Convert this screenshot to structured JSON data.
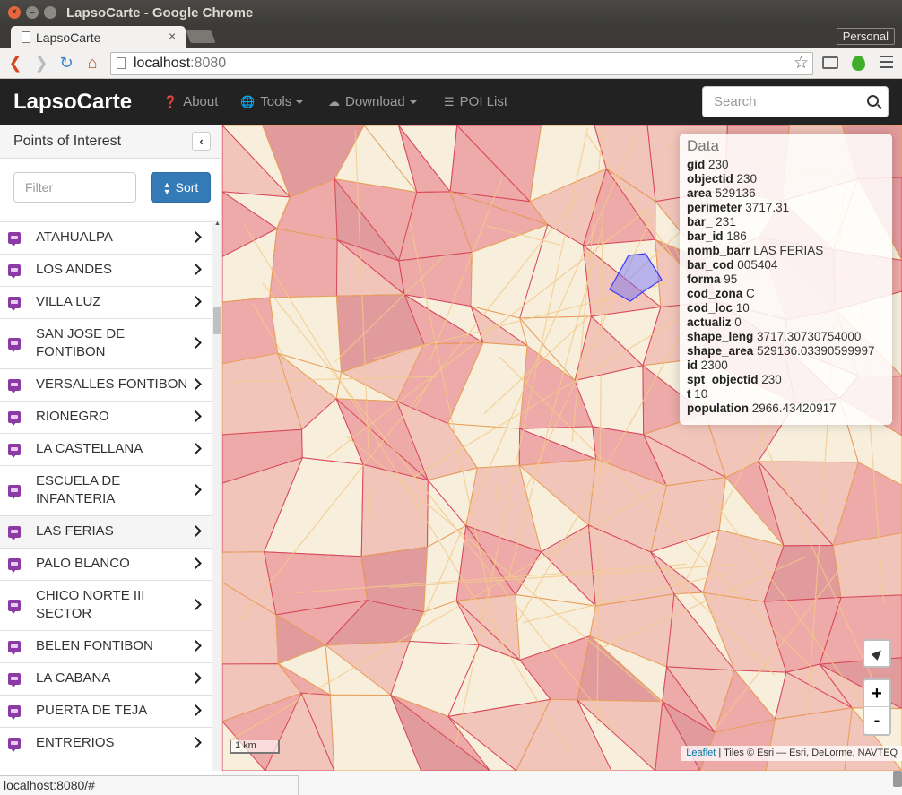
{
  "window": {
    "title": "LapsoCarte - Google Chrome",
    "profile": "Personal"
  },
  "tab": {
    "title": "LapsoCarte",
    "close": "×"
  },
  "omnibox": {
    "host": "localhost",
    "port": ":8080"
  },
  "navbar": {
    "brand": "LapsoCarte",
    "about": "About",
    "tools": "Tools",
    "download": "Download",
    "poi_list": "POI List",
    "search_placeholder": "Search"
  },
  "sidebar": {
    "title": "Points of Interest",
    "filter_placeholder": "Filter",
    "sort_label": "Sort",
    "items": [
      "ATAHUALPA",
      "LOS ANDES",
      "VILLA LUZ",
      "SAN JOSE DE FONTIBON",
      "VERSALLES FONTIBON",
      "RIONEGRO",
      "LA CASTELLANA",
      "ESCUELA DE INFANTERIA",
      "LAS FERIAS",
      "PALO BLANCO",
      "CHICO NORTE III SECTOR",
      "BELEN FONTIBON",
      "LA CABANA",
      "PUERTA DE TEJA",
      "ENTRERIOS"
    ],
    "active_item": "LAS FERIAS"
  },
  "data_panel": {
    "title": "Data",
    "rows": [
      {
        "key": "gid",
        "value": "230"
      },
      {
        "key": "objectid",
        "value": "230"
      },
      {
        "key": "area",
        "value": "529136"
      },
      {
        "key": "perimeter",
        "value": "3717.31"
      },
      {
        "key": "bar_",
        "value": "231"
      },
      {
        "key": "bar_id",
        "value": "186"
      },
      {
        "key": "nomb_barr",
        "value": "LAS FERIAS"
      },
      {
        "key": "bar_cod",
        "value": "005404"
      },
      {
        "key": "forma",
        "value": "95"
      },
      {
        "key": "cod_zona",
        "value": "C"
      },
      {
        "key": "cod_loc",
        "value": "10"
      },
      {
        "key": "actualiz",
        "value": "0"
      },
      {
        "key": "shape_leng",
        "value": "3717.30730754000"
      },
      {
        "key": "shape_area",
        "value": "529136.03390599997"
      },
      {
        "key": "id",
        "value": "2300"
      },
      {
        "key": "spt_objectid",
        "value": "230"
      },
      {
        "key": "t",
        "value": "10"
      },
      {
        "key": "population",
        "value": "2966.43420917"
      }
    ]
  },
  "map": {
    "zoom_in": "+",
    "zoom_out": "-",
    "scale": "1 km",
    "attribution_link": "Leaflet",
    "attribution_text": " | Tiles © Esri — Esri, DeLorme, NAVTEQ"
  },
  "status": "localhost:8080/#",
  "colors": {
    "navbar": "#222222",
    "primary": "#337ab7",
    "poi_icon": "#8c3ba6",
    "polygon_fill": "#e8707a",
    "highlight": "#6b6bff"
  }
}
